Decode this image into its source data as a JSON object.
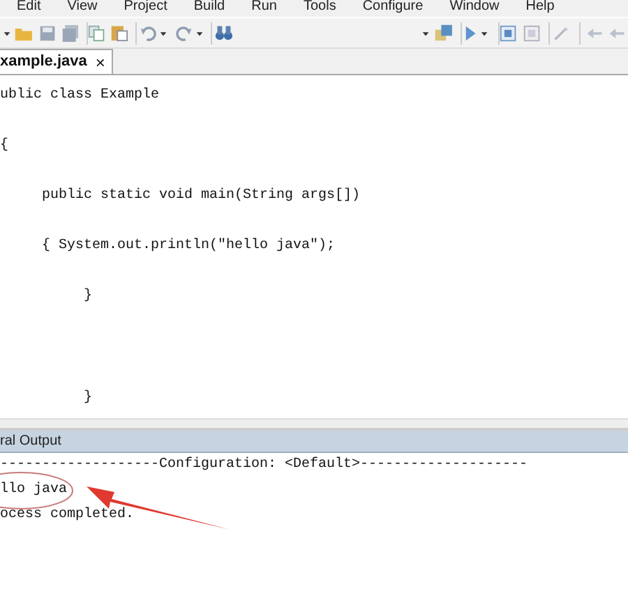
{
  "menu": [
    "Edit",
    "View",
    "Project",
    "Build",
    "Run",
    "Tools",
    "Configure",
    "Window",
    "Help"
  ],
  "editor": {
    "tabs": [
      {
        "label": "xample.java",
        "close": "×",
        "selected": true
      }
    ],
    "lines": [
      "ublic class Example",
      "{",
      "     public static void main(String args[])",
      "     { System.out.println(\"hello java\");",
      "          }",
      "          }"
    ]
  },
  "output": {
    "title": "ral Output",
    "lines": [
      "-------------------Configuration: <Default>--------------------",
      "llo java",
      "ocess completed."
    ]
  }
}
